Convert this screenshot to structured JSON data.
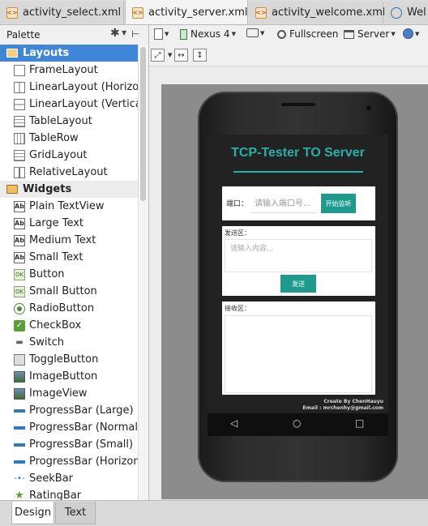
{
  "editor_tabs": [
    {
      "label": "activity_select.xml",
      "close": "×"
    },
    {
      "label": "activity_server.xml",
      "close": "×"
    },
    {
      "label": "activity_welcome.xml",
      "close": "×"
    },
    {
      "label": "Wel",
      "close": ""
    }
  ],
  "palette": {
    "title": "Palette",
    "categories": [
      {
        "label": "Layouts",
        "items": [
          "FrameLayout",
          "LinearLayout (Horizontal)",
          "LinearLayout (Vertical)",
          "TableLayout",
          "TableRow",
          "GridLayout",
          "RelativeLayout"
        ]
      },
      {
        "label": "Widgets",
        "items": [
          "Plain TextView",
          "Large Text",
          "Medium Text",
          "Small Text",
          "Button",
          "Small Button",
          "RadioButton",
          "CheckBox",
          "Switch",
          "ToggleButton",
          "ImageButton",
          "ImageView",
          "ProgressBar (Large)",
          "ProgressBar (Normal)",
          "ProgressBar (Small)",
          "ProgressBar (Horizontal)",
          "SeekBar",
          "RatingBar"
        ]
      }
    ],
    "icon_text": {
      "ab": "Ab",
      "ok": "OK"
    }
  },
  "toolbar": {
    "device": "Nexus 4",
    "fullscreen": "Fullscreen",
    "theme": "Server"
  },
  "bottom_tabs": {
    "design": "Design",
    "text": "Text"
  },
  "app": {
    "title": "TCP-Tester TO Server",
    "port_label": "端口：",
    "port_placeholder": "请输入端口号...",
    "start_button": "开始监听",
    "send_label": "发送区：",
    "send_placeholder": "请输入内容...",
    "send_button": "发送",
    "receive_label": "接收区：",
    "credit_line1": "Create By ChenHauyu",
    "credit_line2": "Email : mrchenhy@gmail.com"
  },
  "colors": {
    "accent": "#29b1a8",
    "button": "#1e9a8f",
    "selection": "#3f86d6"
  }
}
